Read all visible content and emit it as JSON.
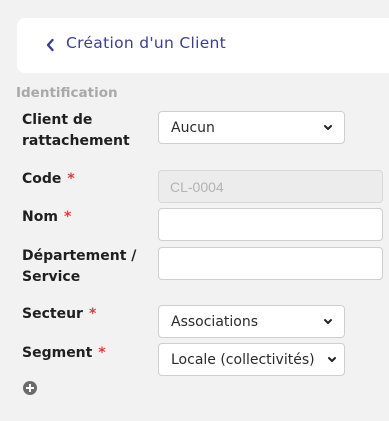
{
  "header": {
    "title": "Création d'un Client"
  },
  "section": {
    "label": "Identification"
  },
  "fields": {
    "client_rattachement": {
      "label_line1": "Client de",
      "label_line2": "rattachement",
      "value": "Aucun"
    },
    "code": {
      "label": "Code",
      "required": "*",
      "value": "CL-0004"
    },
    "nom": {
      "label": "Nom",
      "required": "*",
      "value": ""
    },
    "departement": {
      "label_line1": "Département /",
      "label_line2": "Service",
      "value": ""
    },
    "secteur": {
      "label": "Secteur",
      "required": "*",
      "value": "Associations"
    },
    "segment": {
      "label": "Segment",
      "required": "*",
      "value": "Locale (collectivités)"
    }
  },
  "colors": {
    "accent": "#3b3f8c",
    "required": "#e23b3b",
    "section": "#a9a9a9"
  },
  "icons": {
    "back": "chevron-left-icon",
    "dropdown": "chevron-down-icon",
    "add": "plus-circle-icon"
  }
}
